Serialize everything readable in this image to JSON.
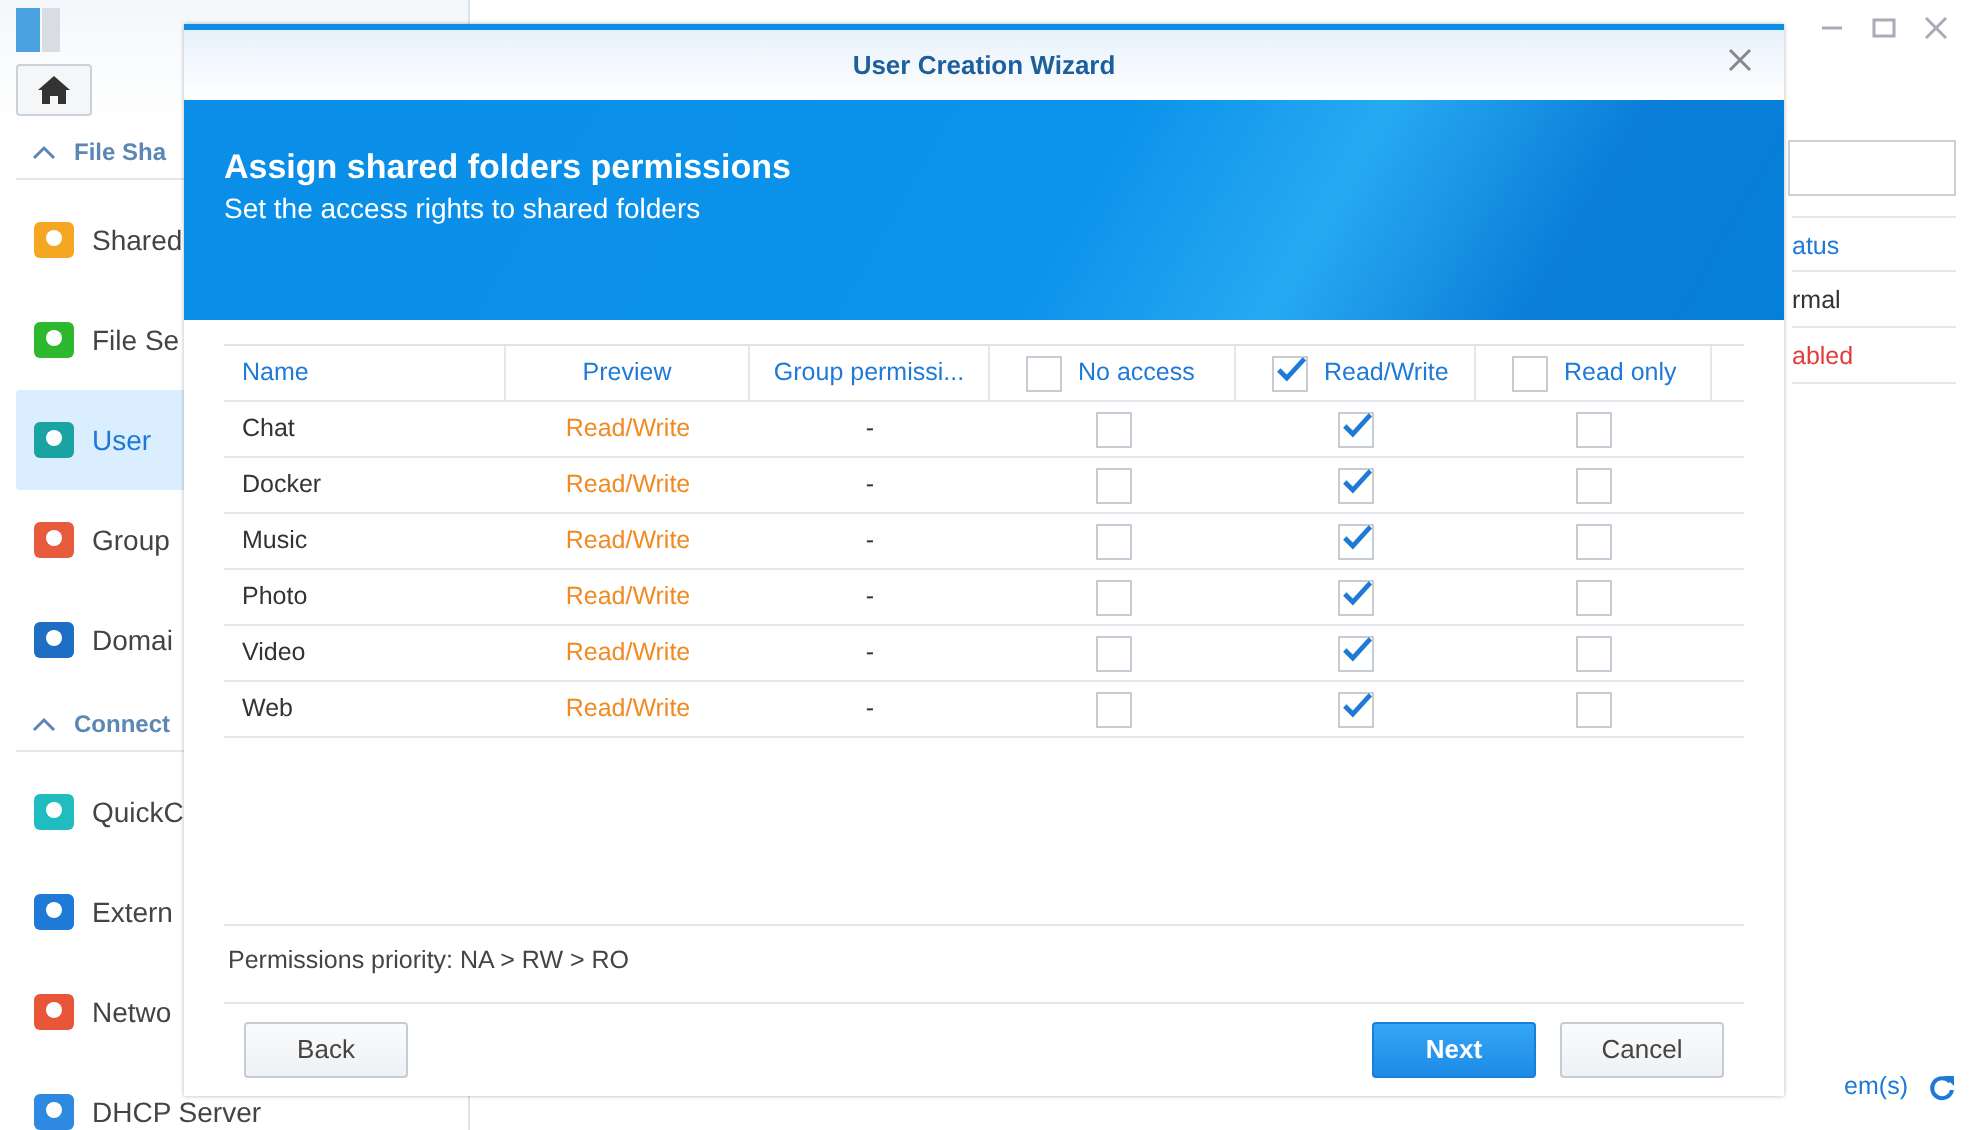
{
  "sidebar": {
    "sections": [
      {
        "title": "File Sha",
        "items": [
          {
            "label": "Shared",
            "selected": false
          },
          {
            "label": "File Se",
            "selected": false
          },
          {
            "label": "User",
            "selected": true
          },
          {
            "label": "Group",
            "selected": false
          },
          {
            "label": "Domai",
            "selected": false
          }
        ]
      },
      {
        "title": "Connect",
        "items": [
          {
            "label": "QuickC",
            "selected": false
          },
          {
            "label": "Extern",
            "selected": false
          },
          {
            "label": "Netwo",
            "selected": false
          },
          {
            "label": "DHCP Server",
            "selected": false
          }
        ]
      }
    ]
  },
  "right_panel": {
    "column_header": "atus",
    "cells": [
      {
        "text": "rmal",
        "kind": "normal"
      },
      {
        "text": "abled",
        "kind": "disabled"
      }
    ],
    "footer": "em(s)"
  },
  "dialog": {
    "title": "User Creation Wizard",
    "heading": "Assign shared folders permissions",
    "subheading": "Set the access rights to shared folders",
    "columns": [
      {
        "label": "Name",
        "kind": "text"
      },
      {
        "label": "Preview",
        "kind": "text"
      },
      {
        "label": "Group permissi...",
        "kind": "text"
      },
      {
        "label": "No access",
        "kind": "checkbox",
        "checked": false
      },
      {
        "label": "Read/Write",
        "kind": "checkbox",
        "checked": true
      },
      {
        "label": "Read only",
        "kind": "checkbox",
        "checked": false
      }
    ],
    "rows": [
      {
        "name": "Chat",
        "preview": "Read/Write",
        "group": "-",
        "no_access": false,
        "read_write": true,
        "read_only": false
      },
      {
        "name": "Docker",
        "preview": "Read/Write",
        "group": "-",
        "no_access": false,
        "read_write": true,
        "read_only": false
      },
      {
        "name": "Music",
        "preview": "Read/Write",
        "group": "-",
        "no_access": false,
        "read_write": true,
        "read_only": false
      },
      {
        "name": "Photo",
        "preview": "Read/Write",
        "group": "-",
        "no_access": false,
        "read_write": true,
        "read_only": false
      },
      {
        "name": "Video",
        "preview": "Read/Write",
        "group": "-",
        "no_access": false,
        "read_write": true,
        "read_only": false
      },
      {
        "name": "Web",
        "preview": "Read/Write",
        "group": "-",
        "no_access": false,
        "read_write": true,
        "read_only": false
      }
    ],
    "note": "Permissions priority: NA > RW > RO",
    "buttons": [
      {
        "label": "Back",
        "kind": "secondary"
      },
      {
        "label": "Next",
        "kind": "primary"
      },
      {
        "label": "Cancel",
        "kind": "secondary"
      }
    ]
  }
}
